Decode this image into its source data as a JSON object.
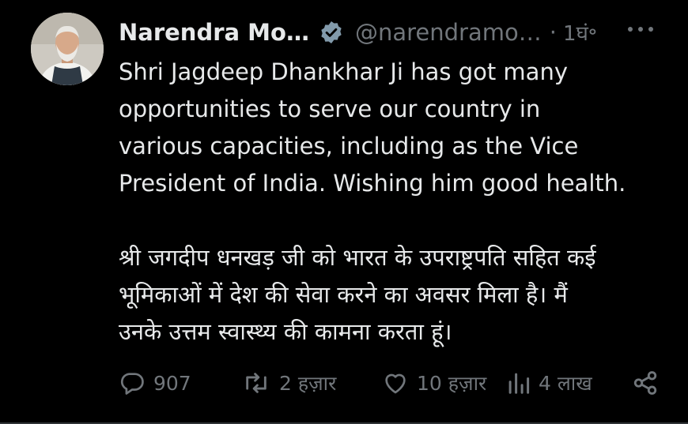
{
  "tweet": {
    "author_name": "Narendra Mo…",
    "handle": "@narendramo…",
    "separator": "·",
    "time": "1घं॰",
    "verified": true,
    "text": "Shri Jagdeep Dhankhar Ji has got many\nopportunities to serve our country in\nvarious capacities, including as the Vice\nPresident of India. Wishing him good health.\n\nश्री जगदीप धनखड़ जी को भारत के उपराष्ट्रपति सहित कई\nभूमिकाओं में देश की सेवा करने का अवसर मिला है। मैं\nउनके उत्तम स्वास्थ्य की कामना करता हूं।"
  },
  "actions": {
    "replies": "907",
    "reposts": "2 हज़ार",
    "likes": "10 हज़ार",
    "views": "4 लाख"
  },
  "icons": {
    "verified": "verified-badge-icon",
    "more": "more-dots-icon",
    "reply": "reply-bubble-icon",
    "repost": "repost-icon",
    "like": "heart-icon",
    "views": "views-chart-icon",
    "share": "share-icon"
  },
  "colors": {
    "background": "#000000",
    "text": "#e7e9ea",
    "muted": "#71767b"
  }
}
